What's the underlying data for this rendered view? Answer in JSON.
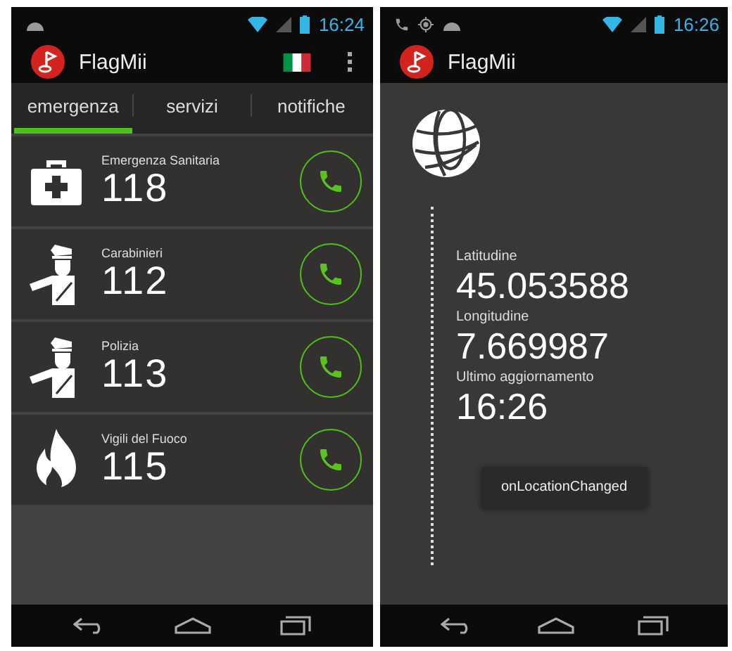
{
  "screens": [
    {
      "kind": "emergency_list",
      "status_bar": {
        "notifications": [
          {
            "kind": "android"
          }
        ],
        "time": "16:24"
      },
      "app_bar": {
        "title": "FlagMii",
        "actions": [
          {
            "kind": "flag"
          },
          {
            "kind": "overflow"
          }
        ]
      },
      "tabs": [
        {
          "label": "emergenza",
          "selected": true
        },
        {
          "label": "servizi",
          "selected": false
        },
        {
          "label": "notifiche",
          "selected": false
        }
      ],
      "contacts": [
        {
          "kind": "medical",
          "name": "Emergenza Sanitaria",
          "number": "118"
        },
        {
          "kind": "officer",
          "name": "Carabinieri",
          "number": "112"
        },
        {
          "kind": "officer",
          "name": "Polizia",
          "number": "113"
        },
        {
          "kind": "fire",
          "name": "Vigili del Fuoco",
          "number": "115"
        }
      ]
    },
    {
      "kind": "location",
      "status_bar": {
        "notifications": [
          {
            "kind": "phone"
          },
          {
            "kind": "gps"
          },
          {
            "kind": "android"
          }
        ],
        "time": "16:26"
      },
      "app_bar": {
        "title": "FlagMii"
      },
      "fields": [
        {
          "label": "Latitudine",
          "value": "45.053588"
        },
        {
          "label": "Longitudine",
          "value": "7.669987"
        },
        {
          "label": "Ultimo aggiornamento",
          "value": "16:26"
        }
      ],
      "toast": "onLocationChanged"
    }
  ]
}
